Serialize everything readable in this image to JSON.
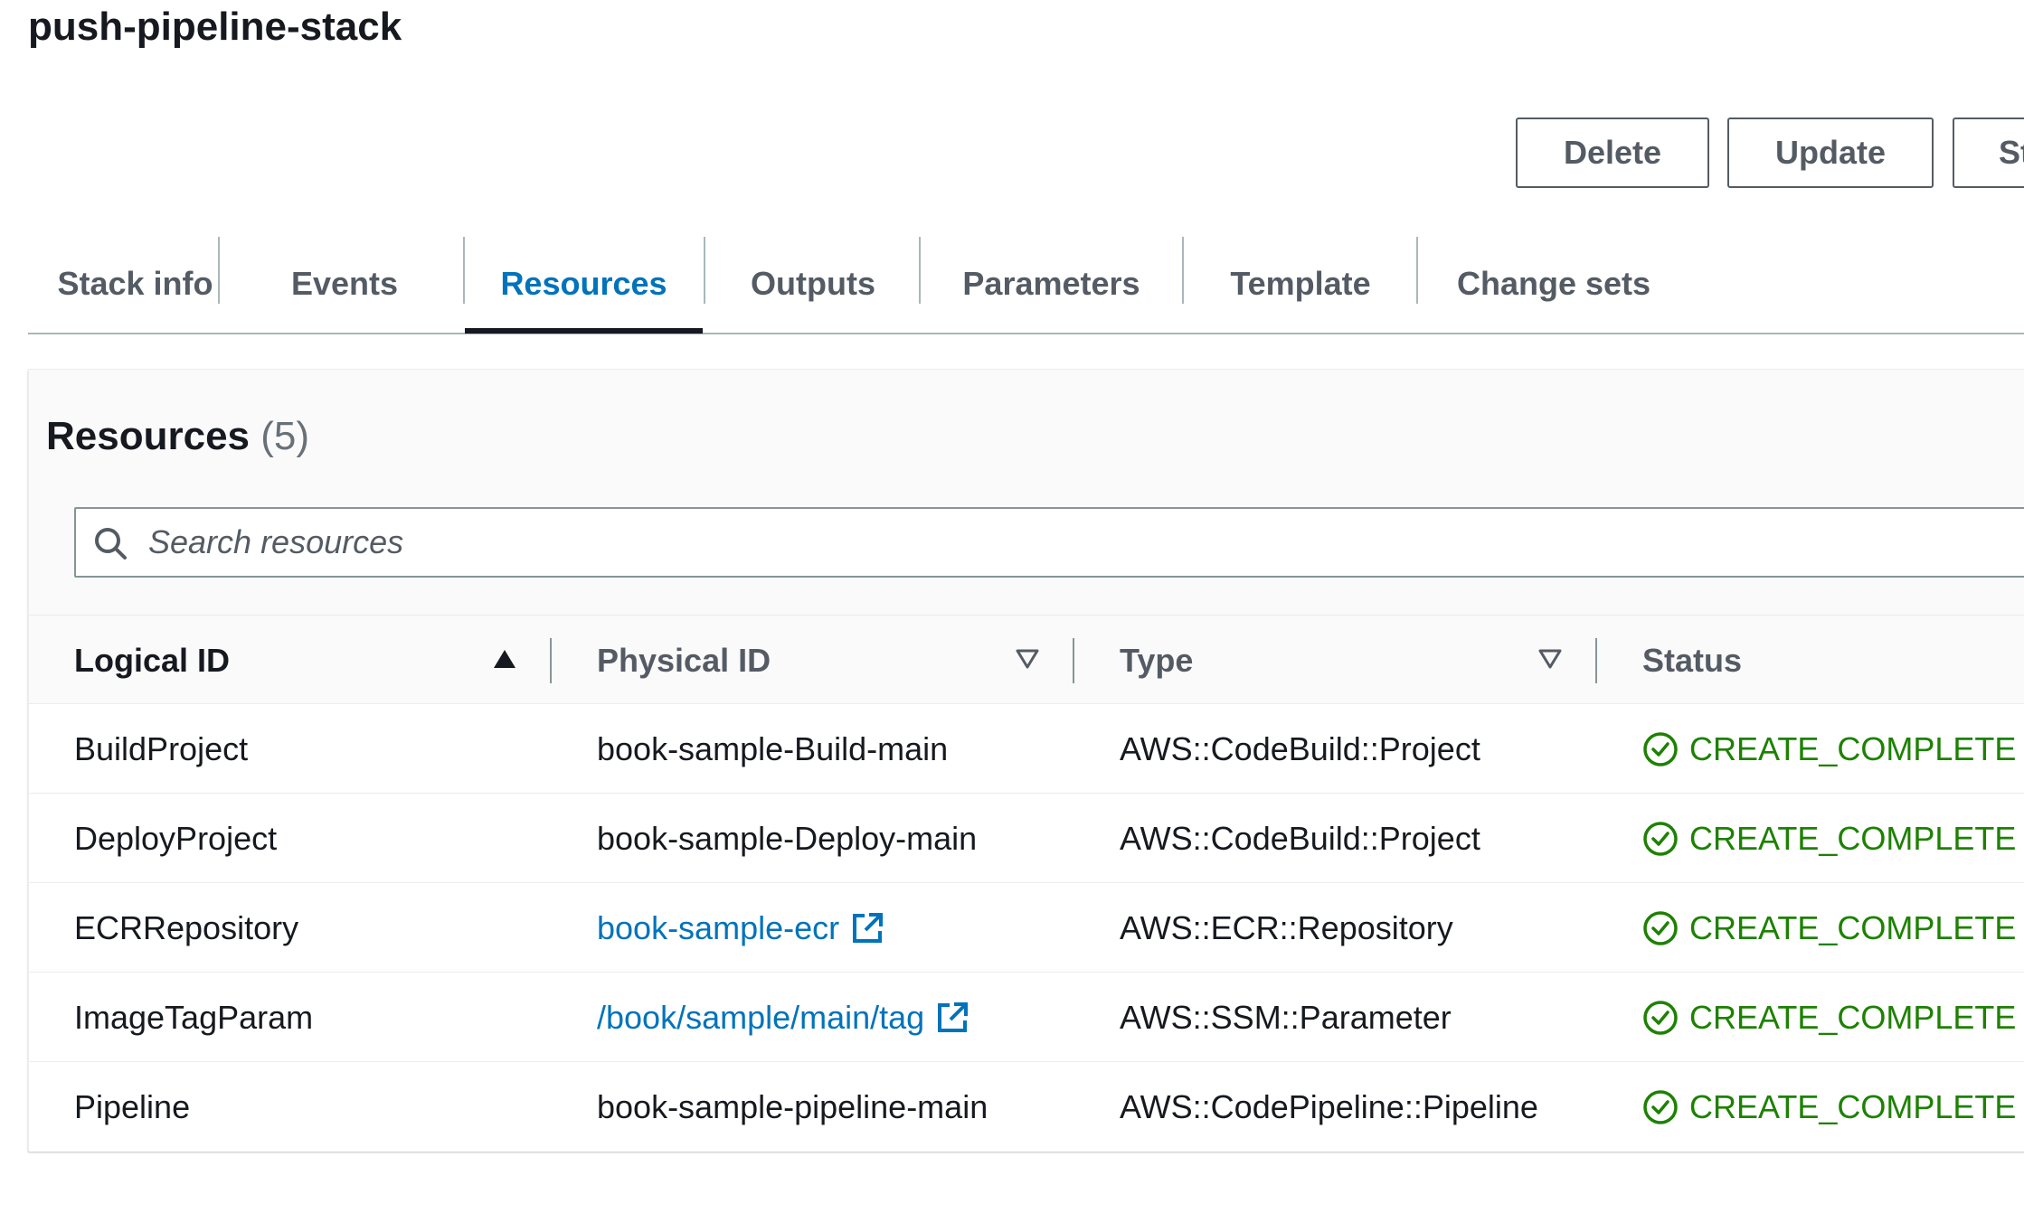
{
  "page": {
    "title": "push-pipeline-stack"
  },
  "actions": {
    "delete_label": "Delete",
    "update_label": "Update",
    "stack_actions_label": "St"
  },
  "tabs": [
    {
      "label": "Stack info",
      "active": false
    },
    {
      "label": "Events",
      "active": false
    },
    {
      "label": "Resources",
      "active": true
    },
    {
      "label": "Outputs",
      "active": false
    },
    {
      "label": "Parameters",
      "active": false
    },
    {
      "label": "Template",
      "active": false
    },
    {
      "label": "Change sets",
      "active": false
    }
  ],
  "resources": {
    "heading": "Resources",
    "count": "(5)",
    "search": {
      "placeholder": "Search resources",
      "value": ""
    },
    "columns": [
      {
        "label": "Logical ID",
        "sort": "ascending"
      },
      {
        "label": "Physical ID",
        "sort": "none"
      },
      {
        "label": "Type",
        "sort": "none"
      },
      {
        "label": "Status",
        "sort": "none"
      }
    ],
    "rows": [
      {
        "logical_id": "BuildProject",
        "physical_id": "book-sample-Build-main",
        "physical_is_link": false,
        "type": "AWS::CodeBuild::Project",
        "status": "CREATE_COMPLETE"
      },
      {
        "logical_id": "DeployProject",
        "physical_id": "book-sample-Deploy-main",
        "physical_is_link": false,
        "type": "AWS::CodeBuild::Project",
        "status": "CREATE_COMPLETE"
      },
      {
        "logical_id": "ECRRepository",
        "physical_id": "book-sample-ecr",
        "physical_is_link": true,
        "type": "AWS::ECR::Repository",
        "status": "CREATE_COMPLETE"
      },
      {
        "logical_id": "ImageTagParam",
        "physical_id": "/book/sample/main/tag",
        "physical_is_link": true,
        "type": "AWS::SSM::Parameter",
        "status": "CREATE_COMPLETE"
      },
      {
        "logical_id": "Pipeline",
        "physical_id": "book-sample-pipeline-main",
        "physical_is_link": false,
        "type": "AWS::CodePipeline::Pipeline",
        "status": "CREATE_COMPLETE"
      }
    ]
  },
  "icons": {
    "search": "search-icon",
    "sort_ascending": "sort-ascending-icon",
    "sort_descending_outline": "sort-caret-down-icon",
    "external_link": "external-link-icon",
    "status_success": "check-circle-icon"
  },
  "colors": {
    "link": "#0073bb",
    "success": "#1d8102",
    "text": "#16191f",
    "muted": "#545b64"
  }
}
